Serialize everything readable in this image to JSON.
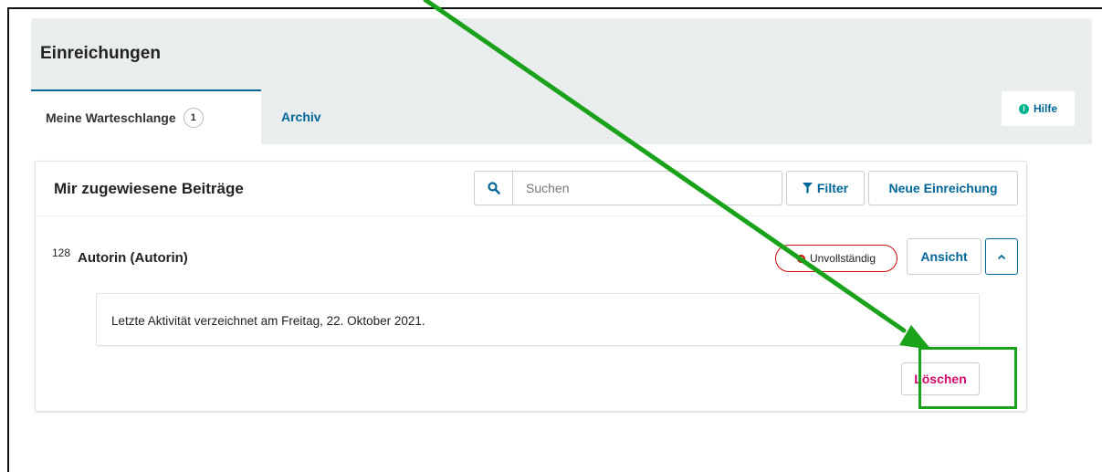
{
  "page": {
    "title": "Einreichungen"
  },
  "tabs": [
    {
      "label": "Meine Warteschlange",
      "badge": "1"
    },
    {
      "label": "Archiv"
    }
  ],
  "help": {
    "label": "Hilfe"
  },
  "card": {
    "title": "Mir zugewiesene Beiträge",
    "search_placeholder": "Suchen",
    "filter_label": "Filter",
    "new_label": "Neue Einreichung"
  },
  "submission": {
    "id": "128",
    "author": "Autorin (Autorin)",
    "status": "Unvollständig",
    "view_label": "Ansicht",
    "activity": "Letzte Aktivität verzeichnet am Freitag, 22. Oktober 2021.",
    "delete_label": "Löschen"
  },
  "colors": {
    "brand": "#006798",
    "danger": "#d00a0a",
    "delete": "#d00a6c",
    "annotation": "#1aa31a"
  }
}
